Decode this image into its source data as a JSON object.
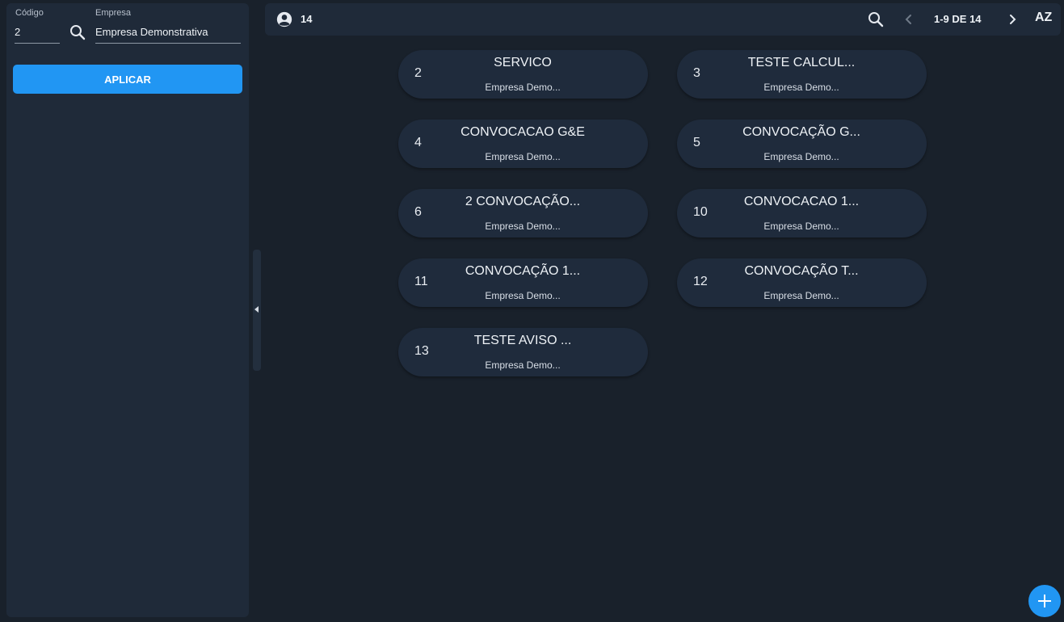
{
  "filters": {
    "codigo_label": "Código",
    "codigo_value": "2",
    "empresa_label": "Empresa",
    "empresa_value": "Empresa Demonstrativa",
    "apply_label": "APLICAR",
    "search_icon": "search-icon"
  },
  "toolbar": {
    "count": "14",
    "count_icon": "account-circle-icon",
    "search_icon": "search-icon",
    "prev_icon": "chevron-left-icon",
    "pager_text": "1-9 DE 14",
    "next_icon": "chevron-right-icon",
    "sort_label": "AZ"
  },
  "cards": [
    {
      "code": "2",
      "name": "SERVICO",
      "company": "Empresa Demo..."
    },
    {
      "code": "3",
      "name": "TESTE CALCUL...",
      "company": "Empresa Demo..."
    },
    {
      "code": "4",
      "name": "CONVOCACAO G&E",
      "company": "Empresa Demo..."
    },
    {
      "code": "5",
      "name": "CONVOCAÇÃO G...",
      "company": "Empresa Demo..."
    },
    {
      "code": "6",
      "name": "2 CONVOCAÇÃO...",
      "company": "Empresa Demo..."
    },
    {
      "code": "10",
      "name": "CONVOCACAO 1...",
      "company": "Empresa Demo..."
    },
    {
      "code": "11",
      "name": "CONVOCAÇÃO 1...",
      "company": "Empresa Demo..."
    },
    {
      "code": "12",
      "name": "CONVOCAÇÃO T...",
      "company": "Empresa Demo..."
    },
    {
      "code": "13",
      "name": "TESTE AVISO ...",
      "company": "Empresa Demo..."
    }
  ],
  "colors": {
    "background": "#19212b",
    "panel": "#1f2a39",
    "accent": "#2196f3"
  }
}
